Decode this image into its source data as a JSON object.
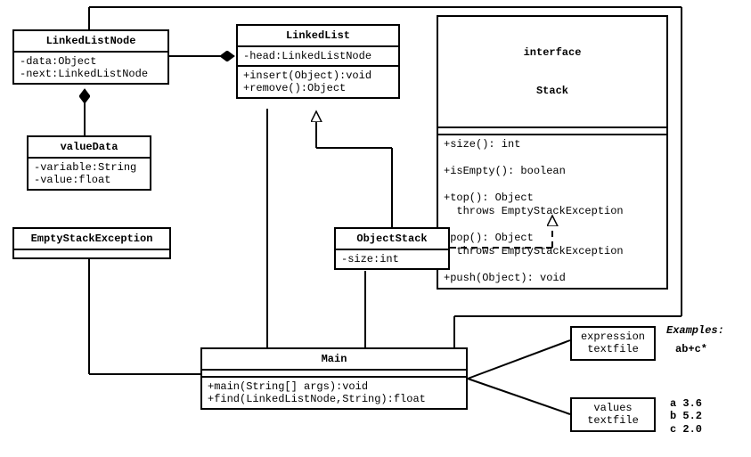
{
  "classes": {
    "linkedListNode": {
      "name": "LinkedListNode",
      "attrs": "-data:Object\n-next:LinkedListNode"
    },
    "linkedList": {
      "name": "LinkedList",
      "attrs": "-head:LinkedListNode",
      "ops": "+insert(Object):void\n+remove():Object"
    },
    "stack": {
      "stereotype": "interface",
      "name": "Stack",
      "ops": "+size(): int\n\n+isEmpty(): boolean\n\n+top(): Object\n  throws EmptyStackException\n\n+pop(): Object\n  throws EmptyStackException\n\n+push(Object): void"
    },
    "valueData": {
      "name": "valueData",
      "attrs": "-variable:String\n-value:float"
    },
    "emptyStackException": {
      "name": "EmptyStackException"
    },
    "objectStack": {
      "name": "ObjectStack",
      "attrs": "-size:int"
    },
    "main": {
      "name": "Main",
      "ops": "+main(String[] args):void\n+find(LinkedListNode,String):float"
    }
  },
  "notes": {
    "expression": "expression\ntextfile",
    "values": "values\ntextfile"
  },
  "examples": {
    "heading": "Examples:",
    "expression": "ab+c*",
    "values": "a 3.6\nb 5.2\nc 2.0"
  }
}
